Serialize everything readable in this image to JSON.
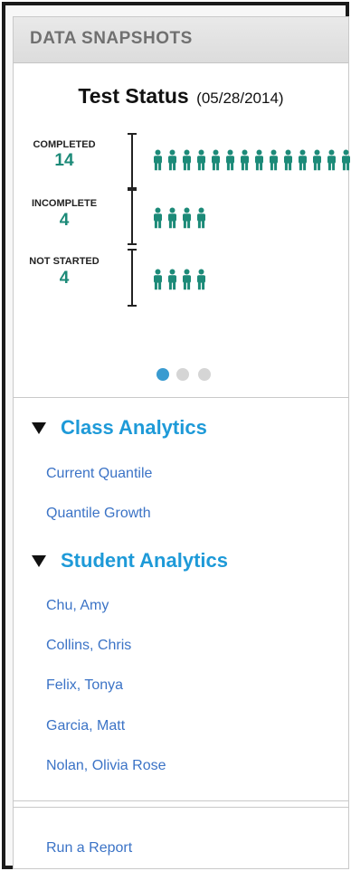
{
  "panel": {
    "title": "DATA SNAPSHOTS"
  },
  "snapshot": {
    "title": "Test Status",
    "date": "(05/28/2014)",
    "icon": "person-icon",
    "icon_color": "#1c8a78",
    "stats": [
      {
        "label": "COMPLETED",
        "count": "14",
        "value": 14
      },
      {
        "label": "INCOMPLETE",
        "count": "4",
        "value": 4
      },
      {
        "label": "NOT STARTED",
        "count": "4",
        "value": 4
      }
    ],
    "carousel": {
      "pages": 3,
      "active": 1
    }
  },
  "class_analytics": {
    "title": "Class Analytics",
    "items": [
      "Current Quantile",
      "Quantile Growth"
    ]
  },
  "student_analytics": {
    "title": "Student Analytics",
    "items": [
      "Chu, Amy",
      "Collins, Chris",
      "Felix, Tonya",
      "Garcia, Matt",
      "Nolan, Olivia Rose"
    ]
  },
  "footer": {
    "run_report": "Run a Report"
  },
  "colors": {
    "accent": "#1e9ad8",
    "link": "#3b73c6",
    "count": "#1c8a78",
    "active_dot": "#3a9bd0"
  }
}
